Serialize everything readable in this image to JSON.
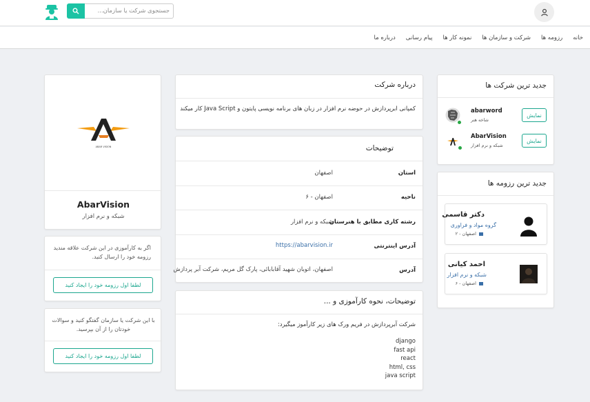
{
  "header": {
    "search_placeholder": "جستجوی شرکت یا سازمان...",
    "nav": [
      "خانه",
      "رزومه ها",
      "شرکت و سازمان ها",
      "نمونه کار ها",
      "پیام رسانی",
      "درباره ما"
    ]
  },
  "company": {
    "name": "AbarVision",
    "category": "شبکه و نرم افزار",
    "logo_text": "ABAR VISION"
  },
  "notice1": {
    "text": "اگر به کارآموزی در این شرکت علاقه مندید رزومه خود را ارسال کنید.",
    "button": "لطفا اول رزومه خود را ایجاد کنید"
  },
  "notice2": {
    "text": "با این شرکت یا سازمان گفتگو کنید و سوالات خودتان را از آن بپرسید.",
    "button": "لطفا اول رزومه خود را ایجاد کنید"
  },
  "about": {
    "title": "درباره شرکت",
    "text": "کمپانی ابرپردازش در حوضه نرم افزار در زبان های برنامه نویسی پایتون و Java Script کار میکند"
  },
  "details": {
    "title": "توضیحات",
    "rows": [
      {
        "label": "استان",
        "value": "اصفهان"
      },
      {
        "label": "ناحیه",
        "value": "۶ - اصفهان"
      },
      {
        "label": "رشته کاری مطابق با هنرستان",
        "value": "شبکه و نرم افزار"
      },
      {
        "label": "آدرس اینترنتی",
        "value": "https://abarvision.ir"
      },
      {
        "label": "آدرس",
        "value": "اصفهان، اتوبان شهید آقابابائی، پارک گل مریم، شرکت آبر پردازش"
      }
    ]
  },
  "training": {
    "title": "توضیحات، نحوه کارآموزی و ...",
    "intro": "شرکت آبرپردازش در فریم ورک های زیر کارآموز میگیرد:",
    "items": [
      "django",
      "fast api",
      "react",
      "html, css",
      "java script"
    ]
  },
  "latest_companies": {
    "title": "جدید ترین شرکت ها",
    "items": [
      {
        "name": "abarword",
        "category": "شاخه هنر",
        "button": "نمایش"
      },
      {
        "name": "AbarVision",
        "category": "شبکه و نرم افزار",
        "button": "نمایش"
      }
    ]
  },
  "latest_resumes": {
    "title": "جدید ترین رزومه ها",
    "items": [
      {
        "name": "دکتر قاسمی",
        "field": "گروه مواد و فراوری",
        "location": "اصفهان - ۲"
      },
      {
        "name": "احمد کیانی",
        "field": "شبکه و نرم افزار",
        "location": "اصفهان - ۶"
      }
    ]
  },
  "colors": {
    "accent": "#1bc3a4",
    "button_border": "#1aa68e",
    "link": "#3a6fa8",
    "online": "#28a745"
  }
}
